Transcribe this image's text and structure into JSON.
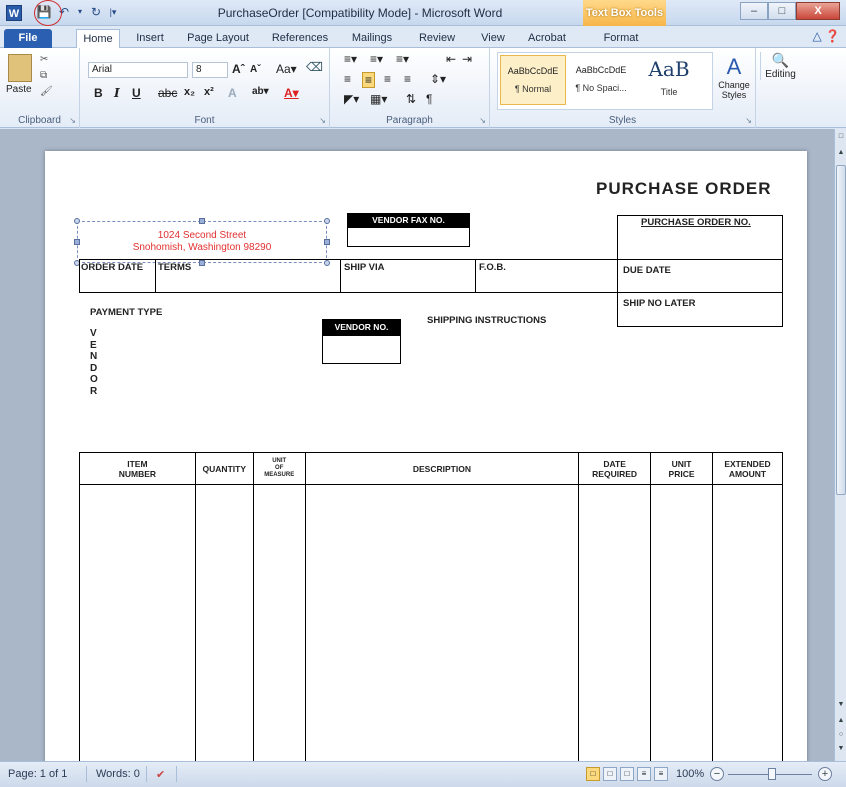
{
  "window": {
    "title": "PurchaseOrder [Compatibility Mode] - Microsoft Word",
    "context_tab_header": "Text Box Tools",
    "app_icon": "W"
  },
  "ribbon_tabs": [
    {
      "label": "File"
    },
    {
      "label": "Home"
    },
    {
      "label": "Insert"
    },
    {
      "label": "Page Layout"
    },
    {
      "label": "References"
    },
    {
      "label": "Mailings"
    },
    {
      "label": "Review"
    },
    {
      "label": "View"
    },
    {
      "label": "Acrobat"
    },
    {
      "label": "Format"
    }
  ],
  "ribbon": {
    "clipboard": {
      "label": "Clipboard",
      "paste": "Paste"
    },
    "font": {
      "label": "Font",
      "name": "Arial",
      "size": "8"
    },
    "paragraph": {
      "label": "Paragraph"
    },
    "styles": {
      "label": "Styles",
      "items": [
        {
          "preview": "AaBbCcDdE",
          "name": "¶ Normal"
        },
        {
          "preview": "AaBbCcDdE",
          "name": "¶ No Spaci..."
        },
        {
          "preview": "AaB",
          "name": "Title"
        }
      ],
      "change_styles": "Change Styles",
      "editing": "Editing"
    }
  },
  "document": {
    "title": "PURCHASE ORDER",
    "address_line1": "1024 Second Street",
    "address_line2": "Snohomish, Washington 98290",
    "vendor_fax_label": "VENDOR FAX NO.",
    "po_no_label": "PURCHASE ORDER NO.",
    "order_date": "ORDER DATE",
    "terms": "TERMS",
    "ship_via": "SHIP VIA",
    "fob": "F.O.B.",
    "due_date": "DUE DATE",
    "ship_no_later": "SHIP NO LATER",
    "payment_type": "PAYMENT TYPE",
    "vendor_no_label": "VENDOR NO.",
    "shipping_instructions": "SHIPPING INSTRUCTIONS",
    "vendor_vertical": [
      "V",
      "E",
      "N",
      "D",
      "O",
      "R"
    ],
    "table_headers": {
      "item_number_1": "ITEM",
      "item_number_2": "NUMBER",
      "quantity": "QUANTITY",
      "unit_1": "UNIT",
      "unit_2": "OF",
      "unit_3": "MEASURE",
      "description": "DESCRIPTION",
      "date_1": "DATE",
      "date_2": "REQUIRED",
      "price_1": "UNIT",
      "price_2": "PRICE",
      "amount_1": "EXTENDED",
      "amount_2": "AMOUNT"
    }
  },
  "status": {
    "page": "Page: 1 of 1",
    "words": "Words: 0",
    "zoom": "100%"
  }
}
